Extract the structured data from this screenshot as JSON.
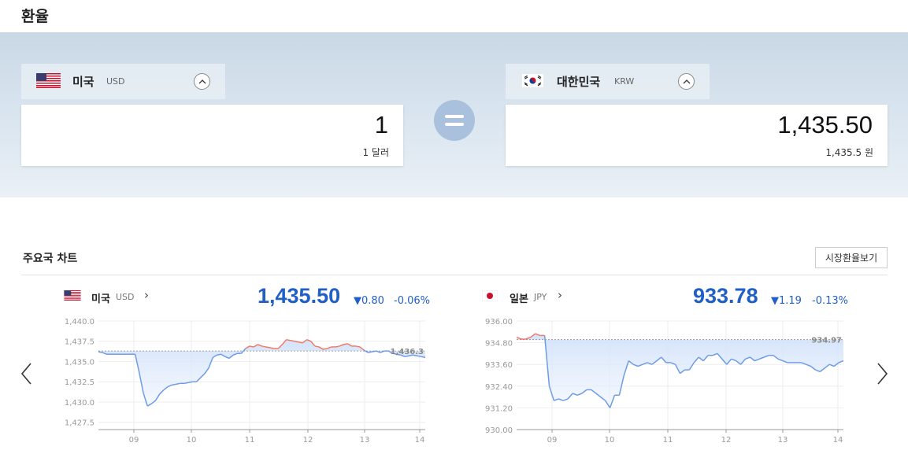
{
  "page": {
    "title": "환율"
  },
  "converter": {
    "from": {
      "name": "미국",
      "code": "USD",
      "amount": "1",
      "amount_text": "1 달러",
      "toggle_icon": "chevron-up-icon"
    },
    "to": {
      "name": "대한민국",
      "code": "KRW",
      "amount": "1,435.50",
      "amount_text": "1,435.5 원",
      "toggle_icon": "chevron-up-icon"
    },
    "equals_icon": "equals-icon"
  },
  "section": {
    "title": "주요국 차트",
    "market_button": "시장환율보기"
  },
  "charts": {
    "usd": {
      "name": "미국",
      "code": "USD",
      "price": "1,435.50",
      "change": "▼0.80",
      "change_pct": "-0.06%",
      "ref_label": "1,436.3"
    },
    "jpy": {
      "name": "일본",
      "code": "JPY",
      "price": "933.78",
      "change": "▼1.19",
      "change_pct": "-0.13%",
      "ref_label": "934.97"
    }
  },
  "colors": {
    "down": "#1f5fc6",
    "up_line": "#f07a6a",
    "down_line": "#6d9be8",
    "banner": "#d6e2ee"
  },
  "chart_data": [
    {
      "type": "line",
      "title": "",
      "x_ticks": [
        "09",
        "10",
        "11",
        "12",
        "13",
        "14"
      ],
      "y_ticks": [
        "1,440.0",
        "1,437.5",
        "1,435.0",
        "1,432.5",
        "1,430.0",
        "1,427.5"
      ],
      "ylim": [
        1426.6,
        1440.0
      ],
      "reference": 1436.3,
      "series": [
        {
          "values": [
            1436.2,
            1436.1,
            1435.9,
            1435.9,
            1435.9,
            1435.9,
            1435.9,
            1435.9,
            1435.9,
            1435.9,
            1433.6,
            1431.1,
            1429.5,
            1429.8,
            1430.2,
            1431.0,
            1431.5,
            1431.9,
            1432.1,
            1432.2,
            1432.3,
            1432.3,
            1432.4,
            1432.5,
            1432.5,
            1433.0,
            1433.5,
            1434.2,
            1435.5,
            1435.8,
            1435.9,
            1435.6,
            1435.4,
            1435.8,
            1436.0,
            1436.0,
            1436.6,
            1436.9,
            1436.8,
            1437.1,
            1436.9,
            1436.8,
            1436.7,
            1436.6,
            1436.6,
            1437.1,
            1437.7,
            1437.6,
            1437.5,
            1437.4,
            1437.3,
            1437.7,
            1437.5,
            1436.9,
            1436.8,
            1436.5,
            1436.6,
            1436.8,
            1436.8,
            1436.9,
            1437.1,
            1437.2,
            1436.9,
            1436.9,
            1436.8,
            1436.4,
            1436.1,
            1436.2,
            1436.3,
            1436.1,
            1436.3,
            1436.3,
            1436.0,
            1435.9,
            1435.8,
            1435.6,
            1435.7,
            1435.8,
            1435.7,
            1435.6,
            1435.5
          ]
        }
      ]
    },
    {
      "type": "line",
      "title": "",
      "x_ticks": [
        "09",
        "10",
        "11",
        "12",
        "13",
        "14"
      ],
      "y_ticks": [
        "936.00",
        "934.80",
        "933.60",
        "932.40",
        "931.20",
        "930.00"
      ],
      "ylim": [
        930.0,
        936.0
      ],
      "reference": 934.97,
      "series": [
        {
          "values": [
            935.1,
            935.0,
            935.0,
            935.1,
            935.3,
            935.2,
            935.2,
            932.4,
            931.6,
            931.7,
            931.6,
            931.7,
            932.0,
            931.9,
            932.0,
            932.2,
            932.2,
            932.0,
            931.8,
            931.6,
            931.2,
            931.9,
            931.9,
            933.0,
            933.8,
            933.6,
            933.5,
            933.6,
            933.7,
            933.6,
            933.8,
            934.0,
            933.7,
            933.7,
            933.6,
            933.1,
            933.3,
            933.3,
            933.7,
            934.0,
            933.8,
            934.1,
            934.1,
            934.2,
            933.9,
            933.6,
            933.9,
            933.8,
            933.6,
            933.9,
            934.0,
            933.8,
            933.9,
            934.0,
            934.1,
            934.1,
            933.9,
            933.8,
            933.7,
            933.7,
            933.7,
            933.7,
            933.6,
            933.5,
            933.3,
            933.2,
            933.4,
            933.6,
            933.5,
            933.7,
            933.8
          ]
        }
      ]
    }
  ]
}
